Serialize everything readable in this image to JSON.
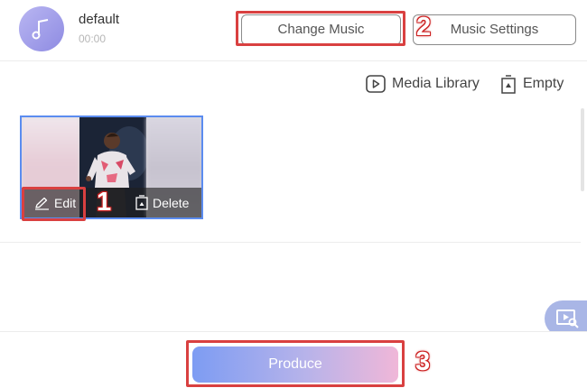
{
  "music": {
    "name": "default",
    "duration": "00:00",
    "change_label": "Change Music",
    "settings_label": "Music Settings"
  },
  "toolbar": {
    "media_library_label": "Media Library",
    "empty_label": "Empty"
  },
  "media_card": {
    "edit_label": "Edit",
    "delete_label": "Delete"
  },
  "footer": {
    "produce_label": "Produce"
  },
  "annotations": {
    "step1": "1",
    "step2": "2",
    "step3": "3"
  },
  "colors": {
    "highlight": "#d94040",
    "selection_border": "#5b8cf0",
    "produce_gradient_start": "#7d9cf3",
    "produce_gradient_end": "#f0b7d8",
    "music_icon_bg": "#a3a0ea"
  },
  "icons": {
    "music": "music-note-icon",
    "media_library": "play-square-icon",
    "empty": "trash-icon",
    "edit": "pencil-icon",
    "delete": "trash-icon",
    "preview": "preview-icon"
  }
}
